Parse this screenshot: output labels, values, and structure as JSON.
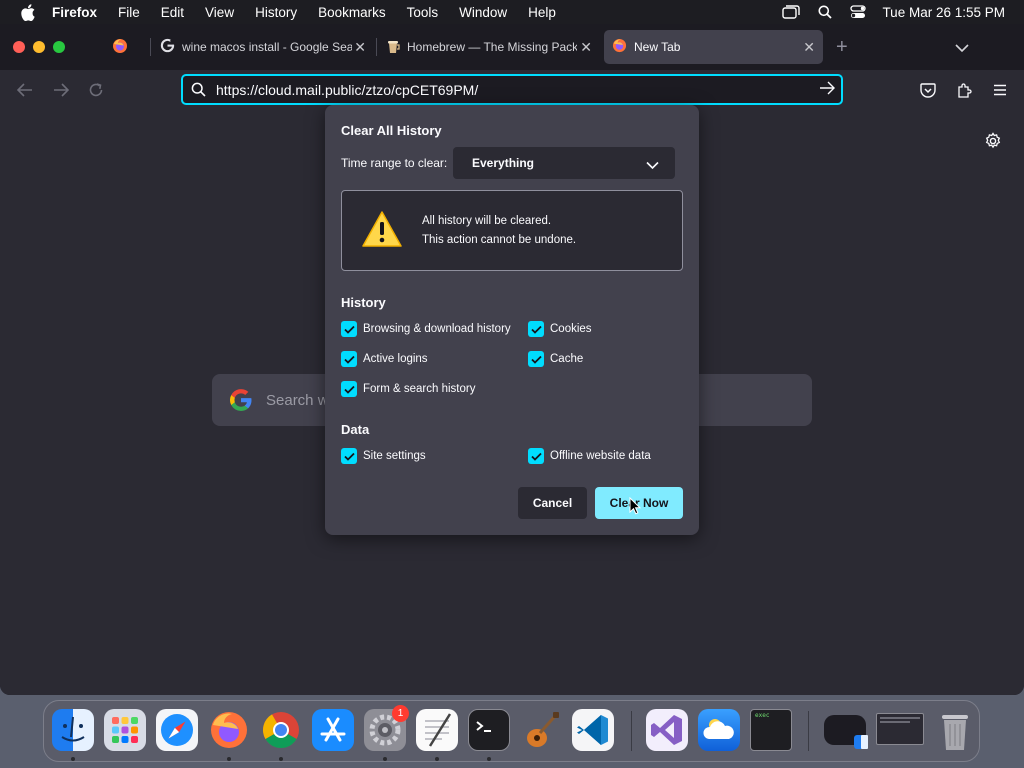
{
  "menubar": {
    "app_name": "Firefox",
    "items": [
      "File",
      "Edit",
      "View",
      "History",
      "Bookmarks",
      "Tools",
      "Window",
      "Help"
    ],
    "clock": "Tue Mar 26  1:55 PM"
  },
  "tabs": [
    {
      "title": "wine macos install - Google Sear",
      "active": false
    },
    {
      "title": "Homebrew — The Missing Package",
      "active": false
    },
    {
      "title": "New Tab",
      "active": true
    }
  ],
  "urlbar": {
    "url": "https://cloud.mail.public/ztzo/cpCET69PM/"
  },
  "newtab": {
    "search_placeholder": "Search w"
  },
  "dialog": {
    "title": "Clear All History",
    "time_range_label": "Time range to clear:",
    "time_range_value": "Everything",
    "warning_line1": "All history will be cleared.",
    "warning_line2": "This action cannot be undone.",
    "history_heading": "History",
    "history_items": [
      {
        "label": "Browsing & download history",
        "checked": true
      },
      {
        "label": "Cookies",
        "checked": true
      },
      {
        "label": "Active logins",
        "checked": true
      },
      {
        "label": "Cache",
        "checked": true
      },
      {
        "label": "Form & search history",
        "checked": true
      }
    ],
    "data_heading": "Data",
    "data_items": [
      {
        "label": "Site settings",
        "checked": true
      },
      {
        "label": "Offline website data",
        "checked": true
      }
    ],
    "cancel_label": "Cancel",
    "clear_label": "Clear Now"
  },
  "dock": {
    "apps": [
      "finder",
      "launchpad",
      "safari",
      "firefox",
      "chrome",
      "app-store",
      "system-settings",
      "textedit",
      "terminal",
      "garageband",
      "vscode",
      "visual-studio",
      "icloud-weather",
      "terminal-exec",
      "window-thumbnail-1",
      "window-thumbnail-2",
      "trash"
    ],
    "settings_badge": "1",
    "exec_label": "exec"
  },
  "colors": {
    "accent": "#00ddff",
    "primary_button": "#80ebff",
    "dialog_bg": "#42414d",
    "content_bg": "#2b2a33"
  }
}
